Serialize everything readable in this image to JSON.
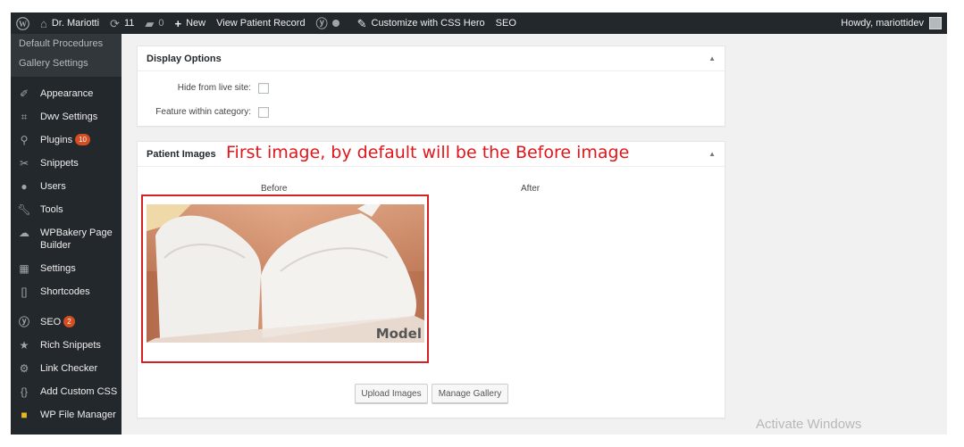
{
  "adminbar": {
    "site_name": "Dr. Mariotti",
    "updates_count": "11",
    "comments_count": "0",
    "new_label": "New",
    "view_record_label": "View Patient Record",
    "customize_label": "Customize with CSS Hero",
    "seo_label": "SEO",
    "howdy": "Howdy, mariottidev"
  },
  "sidebar": {
    "submenu": [
      "Default Procedures",
      "Gallery Settings"
    ],
    "items": [
      {
        "label": "Appearance",
        "icon": "paintbrush-icon"
      },
      {
        "label": "Dwv Settings",
        "icon": "crop-icon"
      },
      {
        "label": "Plugins",
        "icon": "plugin-icon",
        "badge": "10"
      },
      {
        "label": "Snippets",
        "icon": "scissors-icon"
      },
      {
        "label": "Users",
        "icon": "user-icon"
      },
      {
        "label": "Tools",
        "icon": "wrench-icon"
      },
      {
        "label": "WPBakery Page Builder",
        "icon": "cloud-icon"
      },
      {
        "label": "Settings",
        "icon": "settings-icon"
      },
      {
        "label": "Shortcodes",
        "icon": "brackets-icon"
      },
      {
        "label": "SEO",
        "icon": "yoast-icon",
        "badge": "2"
      },
      {
        "label": "Rich Snippets",
        "icon": "star-icon"
      },
      {
        "label": "Link Checker",
        "icon": "gear-icon"
      },
      {
        "label": "Add Custom CSS",
        "icon": "braces-icon"
      },
      {
        "label": "WP File Manager",
        "icon": "folder-icon"
      }
    ]
  },
  "display_options": {
    "title": "Display Options",
    "hide_label": "Hide from live site:",
    "feature_label": "Feature within category:"
  },
  "patient_images": {
    "title": "Patient Images",
    "annotation": "First image, by default will be the Before image",
    "before_label": "Before",
    "after_label": "After",
    "image_watermark": "Model",
    "upload_button": "Upload Images",
    "manage_button": "Manage Gallery"
  },
  "watermark": "Activate Windows",
  "colors": {
    "admin_dark": "#23282d",
    "badge": "#d54e21",
    "annotation_red": "#e3151a"
  }
}
